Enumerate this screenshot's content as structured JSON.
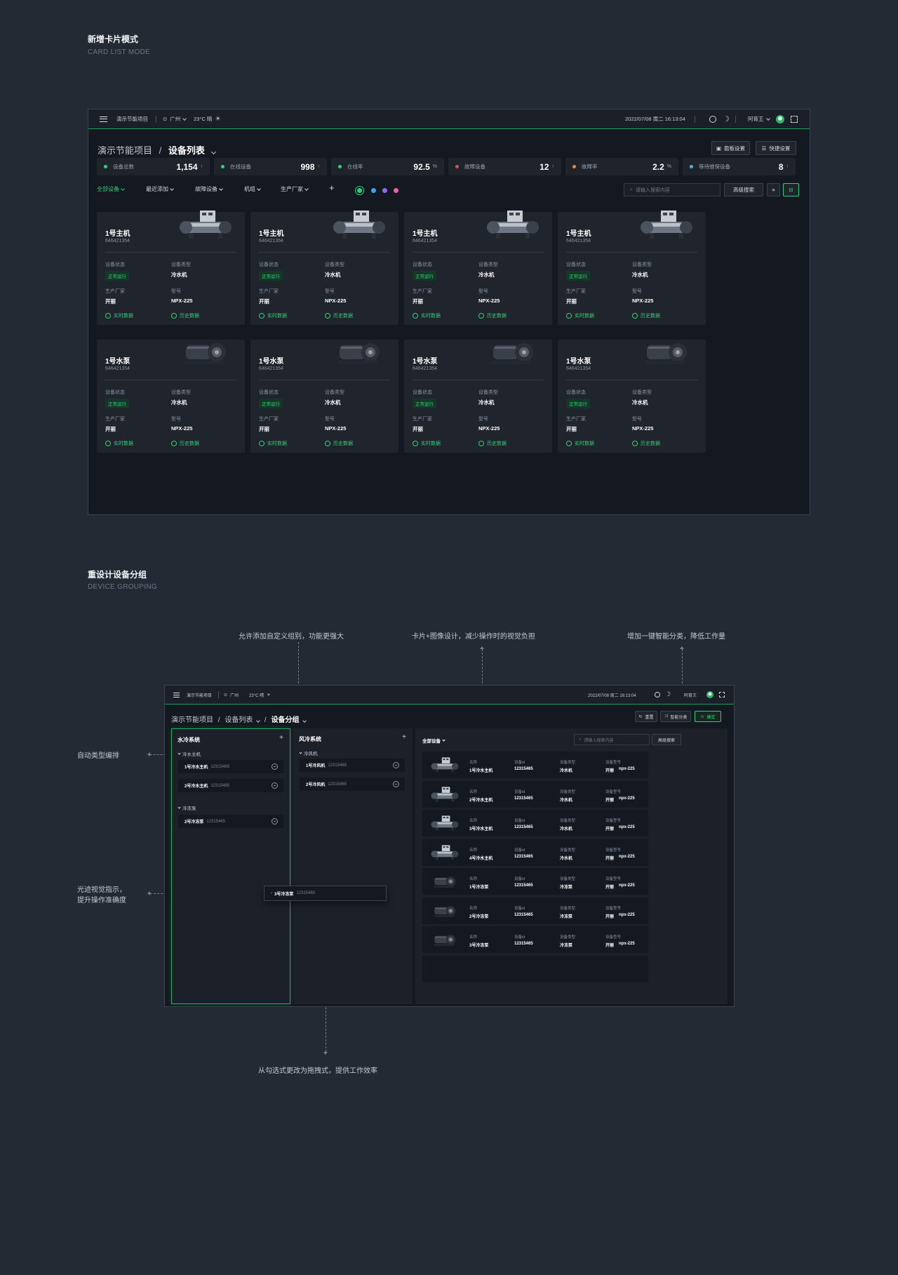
{
  "section1": {
    "title": "新增卡片模式",
    "subtitle": "CARD LIST MODE"
  },
  "section2": {
    "title": "重设计设备分组",
    "subtitle": "DEVICE GROUPING"
  },
  "topbar": {
    "project": "演示节能项目",
    "city": "广州",
    "weather": "23°C 晴",
    "datetime": "2022/07/08 周二 16:13:04",
    "user": "阿育王"
  },
  "breadcrumb1": {
    "a": "演示节能项目",
    "sep": "/",
    "b": "设备列表"
  },
  "breadcrumb2": {
    "a": "演示节能项目",
    "sep1": "/",
    "b": "设备列表",
    "sep2": "/",
    "c": "设备分组"
  },
  "actions1": {
    "panel": "面板设置",
    "quick": "快捷设置"
  },
  "stats": [
    {
      "label": "设备总数",
      "value": "1,154",
      "unit": "↑",
      "color": "#2fd07a"
    },
    {
      "label": "在线设备",
      "value": "998",
      "unit": "↑",
      "color": "#2fd07a"
    },
    {
      "label": "在线率",
      "value": "92.5",
      "unit": "%",
      "color": "#2fd07a"
    },
    {
      "label": "故障设备",
      "value": "12",
      "unit": "↑",
      "color": "#e5484d"
    },
    {
      "label": "故障率",
      "value": "2.2",
      "unit": "%",
      "color": "#f08a3e"
    },
    {
      "label": "等待维保设备",
      "value": "8",
      "unit": "↑",
      "color": "#33b8e6"
    }
  ],
  "filters": {
    "all": "全部设备",
    "recent": "最近添加",
    "fault": "故障设备",
    "unit": "机组",
    "maker": "生产厂家",
    "add": "+"
  },
  "search": {
    "placeholder": "请输入搜索内容",
    "advanced": "高级搜索"
  },
  "card_labels": {
    "status": "设备状态",
    "type": "设备类型",
    "maker": "生产厂家",
    "model": "型号",
    "realtime": "实时数据",
    "history": "历史数据"
  },
  "cards": [
    {
      "name": "1号主机",
      "sn": "646421354",
      "status": "正常运行",
      "type": "冷水机",
      "maker": "开丽",
      "model": "NPX-225",
      "kind": "chiller"
    },
    {
      "name": "1号主机",
      "sn": "646421354",
      "status": "正常运行",
      "type": "冷水机",
      "maker": "开丽",
      "model": "NPX-225",
      "kind": "chiller"
    },
    {
      "name": "1号主机",
      "sn": "646421354",
      "status": "正常运行",
      "type": "冷水机",
      "maker": "开丽",
      "model": "NPX-225",
      "kind": "chiller"
    },
    {
      "name": "1号主机",
      "sn": "646421354",
      "status": "正常运行",
      "type": "冷水机",
      "maker": "开丽",
      "model": "NPX-225",
      "kind": "chiller"
    },
    {
      "name": "1号水泵",
      "sn": "646421354",
      "status": "正常运行",
      "type": "冷水机",
      "maker": "开丽",
      "model": "NPX-225",
      "kind": "pump"
    },
    {
      "name": "1号水泵",
      "sn": "646421354",
      "status": "正常运行",
      "type": "冷水机",
      "maker": "开丽",
      "model": "NPX-225",
      "kind": "pump"
    },
    {
      "name": "1号水泵",
      "sn": "646421354",
      "status": "正常运行",
      "type": "冷水机",
      "maker": "开丽",
      "model": "NPX-225",
      "kind": "pump"
    },
    {
      "name": "1号水泵",
      "sn": "646421354",
      "status": "正常运行",
      "type": "冷水机",
      "maker": "开丽",
      "model": "NPX-225",
      "kind": "pump"
    }
  ],
  "annotations": {
    "a1": "允许添加自定义组别，功能更强大",
    "a2": "卡片+图像设计，减少操作时的视觉负担",
    "a3": "增加一键智能分类，降低工作量",
    "a4": "自动类型编排",
    "a5l1": "光迹视觉指示，",
    "a5l2": "提升操作准确度",
    "a6": "从勾选式更改为拖拽式，提供工作效率"
  },
  "actions2": {
    "reset": "重置",
    "smart": "智能分类",
    "confirm": "确定"
  },
  "groups": {
    "water": {
      "title": "水冷系统",
      "sub1": "冷水主机",
      "sub2": "冷冻泵",
      "items1": [
        {
          "name": "1号冷水主机",
          "id": "12315465"
        },
        {
          "name": "2号冷水主机",
          "id": "12315465"
        }
      ],
      "items2": [
        {
          "name": "2号冷冻泵",
          "id": "12315465"
        }
      ]
    },
    "air": {
      "title": "风冷系统",
      "sub1": "冷风机",
      "items1": [
        {
          "name": "1号冷风机",
          "id": "12315465"
        },
        {
          "name": "2号冷风机",
          "id": "12315465"
        }
      ]
    },
    "drag": {
      "name": "3号冷冻泵",
      "id": "12315465"
    },
    "all": "全部设备"
  },
  "list_labels": {
    "name": "名称",
    "id": "设备id",
    "type": "设备类型",
    "model": "设备型号"
  },
  "list": [
    {
      "name": "1号冷水主机",
      "id": "12315465",
      "type": "冷水机",
      "maker": "开丽",
      "model": "npx-225",
      "kind": "chiller"
    },
    {
      "name": "2号冷水主机",
      "id": "12315465",
      "type": "冷水机",
      "maker": "开丽",
      "model": "npx-225",
      "kind": "chiller"
    },
    {
      "name": "3号冷水主机",
      "id": "12315465",
      "type": "冷水机",
      "maker": "开丽",
      "model": "npx-225",
      "kind": "chiller"
    },
    {
      "name": "4号冷水主机",
      "id": "12315465",
      "type": "冷水机",
      "maker": "开丽",
      "model": "npx-225",
      "kind": "chiller"
    },
    {
      "name": "1号冷冻泵",
      "id": "12315465",
      "type": "冷冻泵",
      "maker": "开丽",
      "model": "npx-225",
      "kind": "pump"
    },
    {
      "name": "2号冷冻泵",
      "id": "12315465",
      "type": "冷冻泵",
      "maker": "开丽",
      "model": "npx-225",
      "kind": "pump"
    },
    {
      "name": "3号冷冻泵",
      "id": "12315465",
      "type": "冷冻泵",
      "maker": "开丽",
      "model": "npx-225",
      "kind": "pump"
    }
  ],
  "colors": {
    "accent": "#2fd07a",
    "filter_dots": [
      "#2fd07a",
      "#3aa6f0",
      "#8e6cf0",
      "#ef5fa7"
    ]
  }
}
